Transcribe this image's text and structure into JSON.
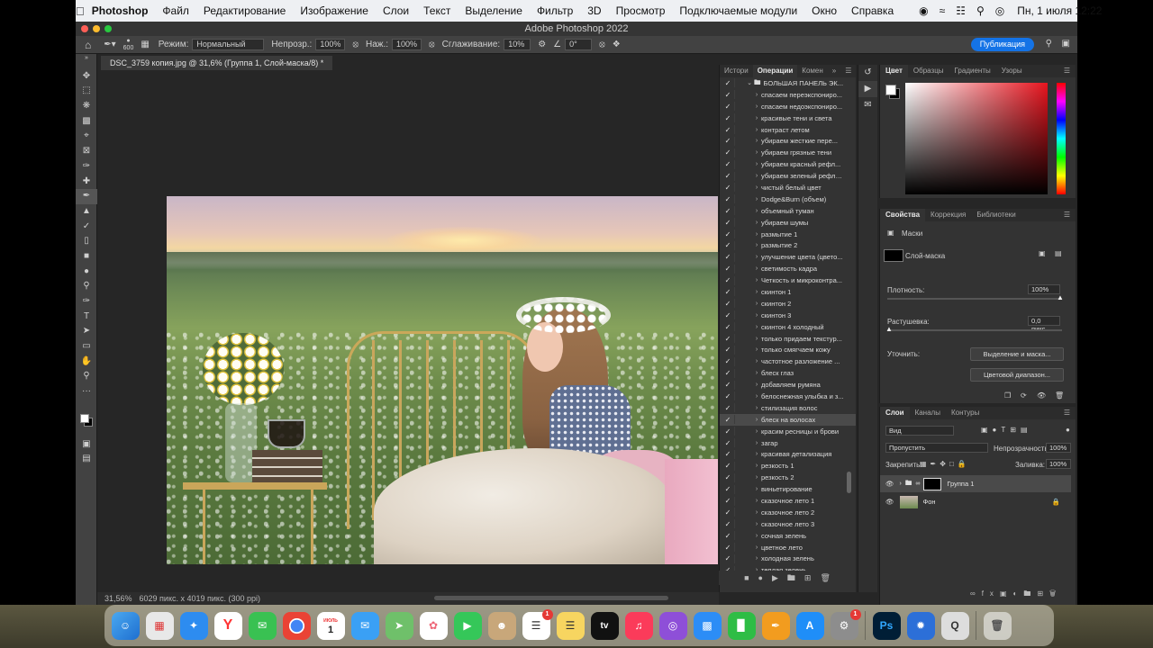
{
  "menubar": {
    "app_name": "Photoshop",
    "items": [
      "Файл",
      "Редактирование",
      "Изображение",
      "Слои",
      "Текст",
      "Выделение",
      "Фильтр",
      "3D",
      "Просмотр",
      "Подключаемые модули",
      "Окно",
      "Справка"
    ],
    "datetime": "Пн, 1 июля  12:22"
  },
  "window": {
    "title": "Adobe Photoshop 2022"
  },
  "options": {
    "brush_size": "600",
    "mode_label": "Режим:",
    "mode_value": "Нормальный",
    "opacity_label": "Непрозр.:",
    "opacity_value": "100%",
    "flow_label": "Наж.:",
    "flow_value": "100%",
    "smoothing_label": "Сглаживание:",
    "smoothing_value": "10%",
    "angle_value": "0°",
    "publish_label": "Публикация"
  },
  "document": {
    "tab_title": "DSC_3759 копия.jpg @ 31,6% (Группа 1, Слой-маска/8) *",
    "zoom": "31,56%",
    "dimensions": "6029 пикс. x 4019 пикс. (300 ppi)"
  },
  "actions_panel": {
    "tabs": [
      "Истори",
      "Операции",
      "Комен"
    ],
    "group_name": "БОЛЬШАЯ ПАНЕЛЬ ЭК...",
    "items": [
      "спасаем переэкспониро...",
      "спасаем недоэкспониро...",
      "красивые тени и света",
      "контраст летом",
      "убираем  жесткие пере...",
      "убираем грязные тени",
      "убираем красный рефл...",
      "убираем зеленый рефле...",
      "чистый белый цвет",
      "Dodge&Burn (объем)",
      "объемный туман",
      "убираем шумы",
      "размытие 1",
      "размытие 2",
      "улучшение цвета (цвето...",
      "светимость кадра",
      "Четкость и микроконтра...",
      "скинтон 1",
      "скинтон 2",
      "скинтон 3",
      "скинтон 4 холодный",
      "только придаем текстур...",
      "только смягчаем кожу",
      "частотное разложение ...",
      "блеск глаз",
      "добавляем румяна",
      "белоснежная улыбка и з...",
      "стилизация волос",
      "блеск на волосах",
      "красим ресницы и брови",
      "загар",
      "красивая детализация",
      "резкость 1",
      "резкость 2",
      "виньетирование",
      "сказочное лето 1",
      "сказочное лето 2",
      "сказочное лето 3",
      "сочная зелень",
      "цветное лето",
      "холодная зелень",
      "теплая зелень"
    ],
    "selected_index": 28
  },
  "color_panel": {
    "tabs": [
      "Цвет",
      "Образцы",
      "Градиенты",
      "Узоры"
    ]
  },
  "properties_panel": {
    "tabs": [
      "Свойства",
      "Коррекция",
      "Библиотеки"
    ],
    "masks_label": "Маски",
    "mask_name": "Слой-маска",
    "density_label": "Плотность:",
    "density_value": "100%",
    "feather_label": "Растушевка:",
    "feather_value": "0,0 пикс.",
    "refine_label": "Уточнить:",
    "select_mask_button": "Выделение и маска...",
    "color_range_button": "Цветовой диапазон..."
  },
  "layers_panel": {
    "tabs": [
      "Слои",
      "Каналы",
      "Контуры"
    ],
    "filter_value": "Вид",
    "blend_mode": "Пропустить",
    "opacity_label": "Непрозрачность:",
    "opacity_value": "100%",
    "lock_label": "Закрепить:",
    "fill_label": "Заливка:",
    "fill_value": "100%",
    "layers": [
      {
        "name": "Группа 1"
      },
      {
        "name": "Фон"
      }
    ]
  },
  "dock": {
    "calendar_month": "ИЮЛЬ",
    "calendar_day": "1",
    "reminders_badge": "1",
    "appletv_label": "tv",
    "ps_label": "Ps"
  },
  "colors": {
    "accent": "#1473e6",
    "panel": "#333333",
    "background": "#262626"
  }
}
